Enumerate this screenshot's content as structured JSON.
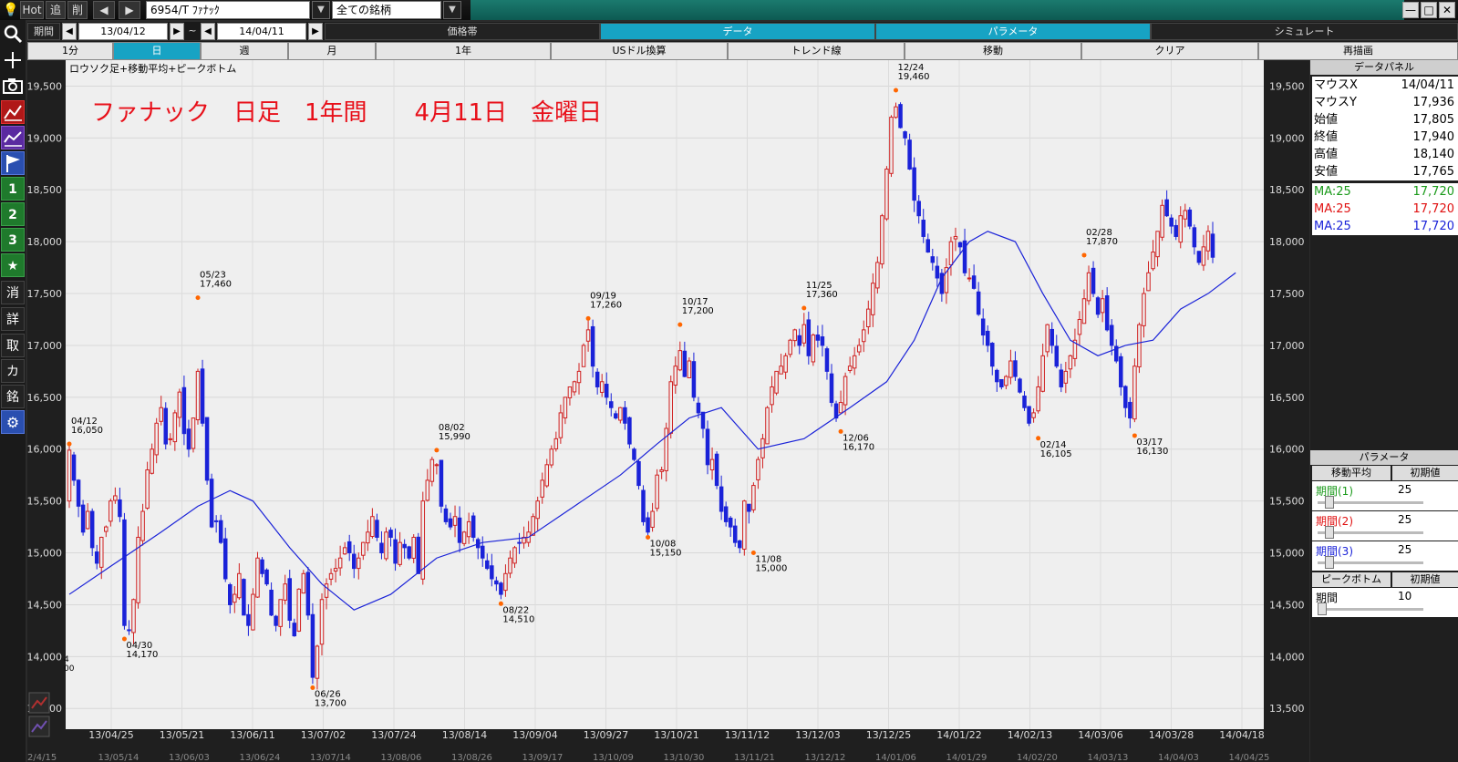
{
  "titlebar": {
    "hot": "Hot",
    "add": "追",
    "del": "削",
    "prev": "◀",
    "next": "▶",
    "symbol": "6954/T ﾌｧﾅｯｸ",
    "universe": "全ての銘柄",
    "dropdown": "▼",
    "min": "—",
    "max": "□",
    "close": "✕"
  },
  "row2": {
    "period_label": "期間",
    "start_date": "13/04/12",
    "tilde": "~",
    "end_date": "14/04/11",
    "tabs": [
      "価格帯",
      "データ",
      "パラメータ",
      "シミュレート"
    ]
  },
  "row3": {
    "tabs": [
      "1分",
      "日",
      "週",
      "月",
      "1年",
      "USドル換算",
      "トレンド線",
      "移動",
      "クリア",
      "再描画"
    ]
  },
  "lefttb": {
    "icons": [
      "search-icon",
      "plus-icon",
      "camera-icon",
      "candle-chart-icon",
      "line-chart-icon",
      "flag-icon"
    ],
    "num": [
      "1",
      "2",
      "3",
      "★"
    ],
    "kanji": [
      "消",
      "詳",
      "取",
      "カ",
      "銘"
    ],
    "gear": "⚙"
  },
  "chart": {
    "legend": "ロウソク足+移動平均+ピークボトム",
    "annotation": "ファナック　日足　1年間　　4月11日　金曜日",
    "annotation_color": "#e8101a",
    "up_color": "#d02020",
    "down_color": "#1a22d8",
    "ma_color": "#1a22d8",
    "peak_color": "#ff6600",
    "left_partial_labels": [
      "4",
      "00"
    ]
  },
  "chart_data": {
    "type": "candlestick",
    "ylim": [
      13300,
      19750
    ],
    "yticks": [
      13500,
      14000,
      14500,
      15000,
      15500,
      16000,
      16500,
      17000,
      17500,
      18000,
      18500,
      19000,
      19500
    ],
    "ytick_labels": [
      "13,500",
      "14,000",
      "14,500",
      "15,000",
      "15,500",
      "16,000",
      "16,500",
      "17,000",
      "17,500",
      "18,000",
      "18,500",
      "19,000",
      "19,500"
    ],
    "xtick_labels": [
      "13/04/25",
      "13/05/21",
      "13/06/11",
      "13/07/02",
      "13/07/24",
      "13/08/14",
      "13/09/04",
      "13/09/27",
      "13/10/21",
      "13/11/12",
      "13/12/03",
      "13/12/25",
      "14/01/22",
      "14/02/13",
      "14/03/06",
      "14/03/28",
      "14/04/18"
    ],
    "bottom_labels": [
      "2/4/15",
      "13/05/14",
      "13/06/03",
      "13/06/24",
      "13/07/14",
      "13/08/06",
      "13/08/26",
      "13/09/17",
      "13/10/09",
      "13/10/30",
      "13/11/21",
      "13/12/12",
      "14/01/06",
      "14/01/29",
      "14/02/20",
      "14/03/13",
      "14/04/03",
      "14/04/25"
    ],
    "peaks": [
      {
        "d": "04/12",
        "v": "16,050",
        "val": 16050,
        "i": 0,
        "pos": "above"
      },
      {
        "d": "04/30",
        "v": "14,170",
        "val": 14170,
        "i": 12,
        "pos": "below"
      },
      {
        "d": "05/23",
        "v": "17,460",
        "val": 17460,
        "i": 28,
        "pos": "above"
      },
      {
        "d": "06/26",
        "v": "13,700",
        "val": 13700,
        "i": 53,
        "pos": "below"
      },
      {
        "d": "08/02",
        "v": "15,990",
        "val": 15990,
        "i": 80,
        "pos": "above"
      },
      {
        "d": "08/22",
        "v": "14,510",
        "val": 14510,
        "i": 94,
        "pos": "below"
      },
      {
        "d": "09/19",
        "v": "17,260",
        "val": 17260,
        "i": 113,
        "pos": "above"
      },
      {
        "d": "10/08",
        "v": "15,150",
        "val": 15150,
        "i": 126,
        "pos": "below"
      },
      {
        "d": "10/17",
        "v": "17,200",
        "val": 17200,
        "i": 133,
        "pos": "above"
      },
      {
        "d": "11/08",
        "v": "15,000",
        "val": 15000,
        "i": 149,
        "pos": "below"
      },
      {
        "d": "11/25",
        "v": "17,360",
        "val": 17360,
        "i": 160,
        "pos": "above"
      },
      {
        "d": "12/06",
        "v": "16,170",
        "val": 16170,
        "i": 168,
        "pos": "below"
      },
      {
        "d": "12/24",
        "v": "19,460",
        "val": 19460,
        "i": 180,
        "pos": "above"
      },
      {
        "d": "02/14",
        "v": "16,105",
        "val": 16105,
        "i": 211,
        "pos": "below"
      },
      {
        "d": "02/28",
        "v": "17,870",
        "val": 17870,
        "i": 221,
        "pos": "above"
      },
      {
        "d": "03/17",
        "v": "16,130",
        "val": 16130,
        "i": 232,
        "pos": "below"
      }
    ],
    "closes": [
      15990,
      15700,
      15450,
      15200,
      15400,
      15050,
      14900,
      15150,
      15250,
      15500,
      15550,
      15350,
      14300,
      14250,
      14550,
      15150,
      15400,
      15800,
      16000,
      16250,
      16400,
      16050,
      16100,
      16350,
      16550,
      16150,
      16000,
      16300,
      16750,
      16250,
      15700,
      15250,
      15300,
      15100,
      14750,
      14500,
      14600,
      14800,
      14400,
      14300,
      14600,
      14950,
      14800,
      14700,
      14400,
      14300,
      14550,
      14700,
      14350,
      14200,
      14650,
      14800,
      14400,
      13800,
      14100,
      14550,
      14700,
      14800,
      14850,
      14950,
      15050,
      15000,
      14850,
      14950,
      15100,
      15200,
      15350,
      15150,
      15000,
      15200,
      15150,
      14900,
      15100,
      15050,
      14950,
      15150,
      14800,
      15500,
      15700,
      15900,
      15850,
      15450,
      15300,
      15250,
      15350,
      15100,
      15200,
      15300,
      15150,
      15050,
      14950,
      14850,
      14750,
      14700,
      14600,
      14800,
      14950,
      15050,
      15100,
      15150,
      15200,
      15350,
      15500,
      15700,
      15850,
      16000,
      16100,
      16350,
      16500,
      16600,
      16650,
      16750,
      17000,
      17150,
      16800,
      16600,
      16650,
      16500,
      16400,
      16300,
      16400,
      16250,
      16050,
      15900,
      15650,
      15300,
      15200,
      15400,
      15750,
      15800,
      16200,
      16650,
      16800,
      16950,
      16700,
      16850,
      16500,
      16350,
      16200,
      15850,
      15900,
      15650,
      15400,
      15300,
      15250,
      15100,
      15050,
      15500,
      15400,
      15650,
      15900,
      16100,
      16400,
      16600,
      16750,
      16800,
      16900,
      17050,
      17150,
      17000,
      17200,
      16900,
      17100,
      17050,
      17000,
      16750,
      16450,
      16300,
      16450,
      16700,
      16800,
      16900,
      17000,
      17150,
      17350,
      17600,
      17800,
      18250,
      18700,
      19200,
      19300,
      19100,
      19000,
      18700,
      18400,
      18250,
      18050,
      17900,
      17800,
      17650,
      17500,
      17750,
      18000,
      18050,
      17950,
      17700,
      17650,
      17550,
      17300,
      17100,
      17000,
      16800,
      16650,
      16600,
      16700,
      16850,
      16700,
      16550,
      16400,
      16250,
      16350,
      16600,
      16900,
      17200,
      17000,
      16800,
      16600,
      16750,
      16900,
      17050,
      17250,
      17450,
      17700,
      17500,
      17300,
      17450,
      17150,
      17000,
      16850,
      16600,
      16400,
      16300,
      16800,
      17200,
      17500,
      17700,
      17900,
      18100,
      18350,
      18250,
      18150,
      18050,
      18250,
      18300,
      18150,
      17950,
      17800,
      17950,
      18100,
      17850
    ],
    "ma": [
      [
        0,
        14600
      ],
      [
        10,
        14900
      ],
      [
        20,
        15200
      ],
      [
        28,
        15450
      ],
      [
        35,
        15600
      ],
      [
        40,
        15500
      ],
      [
        48,
        15050
      ],
      [
        55,
        14700
      ],
      [
        62,
        14450
      ],
      [
        70,
        14600
      ],
      [
        80,
        14950
      ],
      [
        90,
        15100
      ],
      [
        100,
        15150
      ],
      [
        110,
        15450
      ],
      [
        120,
        15750
      ],
      [
        128,
        16050
      ],
      [
        135,
        16300
      ],
      [
        142,
        16400
      ],
      [
        150,
        16000
      ],
      [
        160,
        16100
      ],
      [
        170,
        16400
      ],
      [
        178,
        16650
      ],
      [
        184,
        17050
      ],
      [
        190,
        17650
      ],
      [
        196,
        18000
      ],
      [
        200,
        18100
      ],
      [
        206,
        18000
      ],
      [
        212,
        17500
      ],
      [
        218,
        17050
      ],
      [
        224,
        16900
      ],
      [
        230,
        17000
      ],
      [
        236,
        17050
      ],
      [
        242,
        17350
      ],
      [
        248,
        17500
      ],
      [
        254,
        17700
      ]
    ],
    "current_ma": 17720
  },
  "data_panel": {
    "title": "データパネル",
    "rows": [
      {
        "k": "マウスX",
        "v": "14/04/11",
        "color": "#000"
      },
      {
        "k": "マウスY",
        "v": "17,936",
        "color": "#000"
      },
      {
        "k": "始値",
        "v": "17,805",
        "color": "#000"
      },
      {
        "k": "終値",
        "v": "17,940",
        "color": "#000"
      },
      {
        "k": "高値",
        "v": "18,140",
        "color": "#000"
      },
      {
        "k": "安値",
        "v": "17,765",
        "color": "#000"
      },
      {
        "k": "MA:25",
        "v": "17,720",
        "color": "#1a9a1a"
      },
      {
        "k": "MA:25",
        "v": "17,720",
        "color": "#e01010"
      },
      {
        "k": "MA:25",
        "v": "17,720",
        "color": "#1a22d8"
      }
    ]
  },
  "params": {
    "title": "パラメータ",
    "ma_label": "移動平均",
    "init": "初期値",
    "periods": [
      {
        "label": "期間(1)",
        "val": "25",
        "color": "#1a9a1a"
      },
      {
        "label": "期間(2)",
        "val": "25",
        "color": "#e01010"
      },
      {
        "label": "期間(3)",
        "val": "25",
        "color": "#1a22d8"
      }
    ],
    "pb_label": "ピークボトム",
    "pb_init": "初期値",
    "pb_period_label": "期間",
    "pb_period_val": "10"
  }
}
